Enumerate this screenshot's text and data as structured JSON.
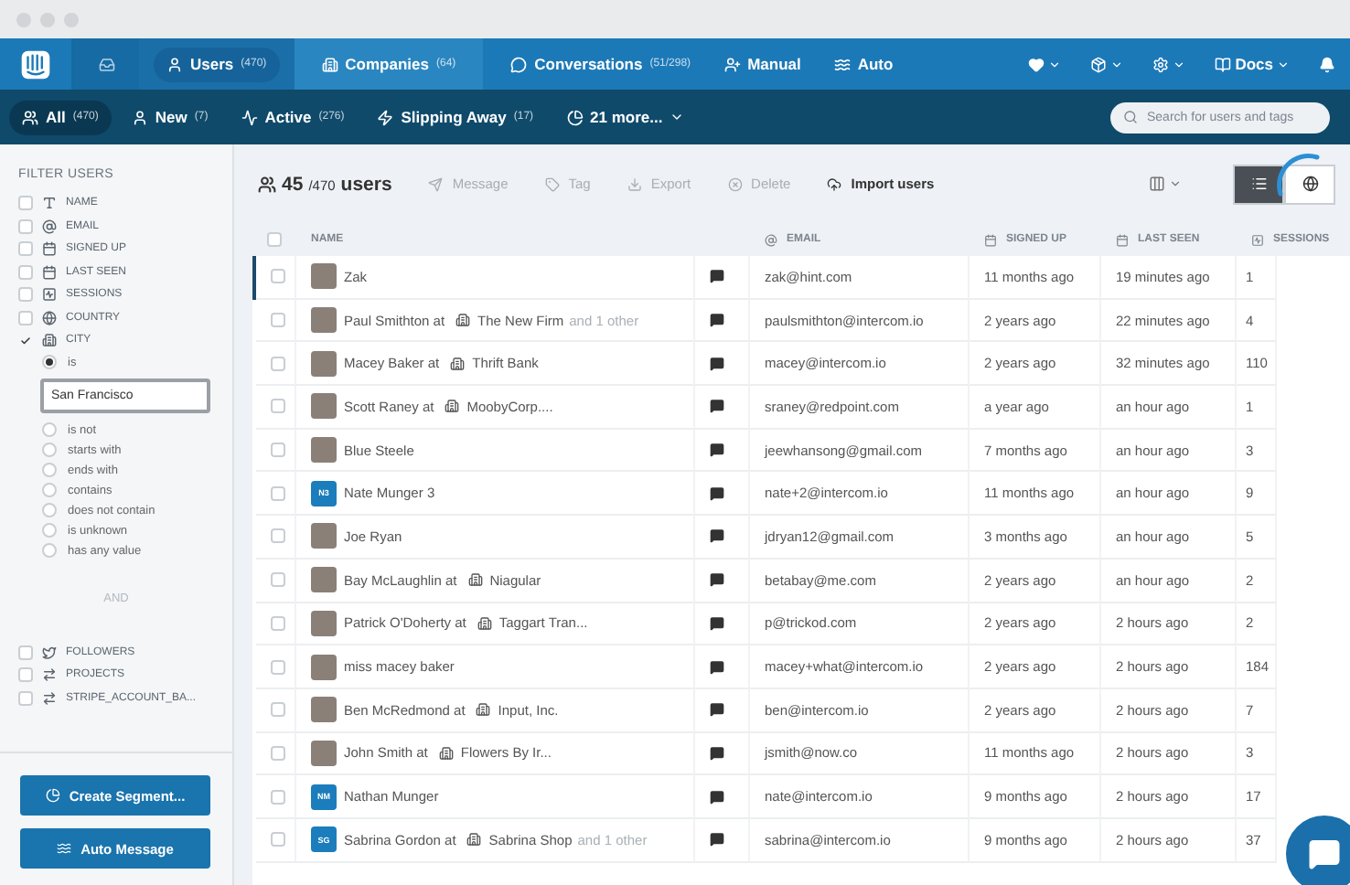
{
  "nav": {
    "tabs": [
      {
        "label": "Users",
        "count": "(470)",
        "selected": true
      },
      {
        "label": "Companies",
        "count": "(64)",
        "selected": false
      },
      {
        "label": "Conversations",
        "count": "(51/298)",
        "selected": false
      },
      {
        "label": "Manual",
        "selected": false
      },
      {
        "label": "Auto",
        "selected": false
      }
    ],
    "docs": "Docs"
  },
  "segments": {
    "items": [
      {
        "label": "All",
        "count": "(470)",
        "selected": true
      },
      {
        "label": "New",
        "count": "(7)",
        "selected": false
      },
      {
        "label": "Active",
        "count": "(276)",
        "selected": false
      },
      {
        "label": "Slipping Away",
        "count": "(17)",
        "selected": false
      },
      {
        "label": "21 more...",
        "selected": false
      }
    ],
    "search_placeholder": "Search for users and tags"
  },
  "sidebar": {
    "title": "FILTER USERS",
    "filters": [
      {
        "label": "NAME",
        "checked": false
      },
      {
        "label": "EMAIL",
        "checked": false
      },
      {
        "label": "SIGNED UP",
        "checked": false
      },
      {
        "label": "LAST SEEN",
        "checked": false
      },
      {
        "label": "SESSIONS",
        "checked": false
      },
      {
        "label": "COUNTRY",
        "checked": false
      },
      {
        "label": "CITY",
        "checked": true
      }
    ],
    "city_value": "San Francisco",
    "city_options": [
      {
        "label": "is",
        "selected": true
      },
      {
        "label": "is not",
        "selected": false
      },
      {
        "label": "starts with",
        "selected": false
      },
      {
        "label": "ends with",
        "selected": false
      },
      {
        "label": "contains",
        "selected": false
      },
      {
        "label": "does not contain",
        "selected": false
      },
      {
        "label": "is unknown",
        "selected": false
      },
      {
        "label": "has any value",
        "selected": false
      }
    ],
    "joiner": "AND",
    "more_filters": [
      {
        "label": "FOLLOWERS",
        "checked": false
      },
      {
        "label": "PROJECTS",
        "checked": false
      },
      {
        "label": "STRIPE_ACCOUNT_BA...",
        "checked": false
      }
    ],
    "buttons": [
      "Create Segment...",
      "Auto Message"
    ]
  },
  "toolbar": {
    "count": "45",
    "total": "/470",
    "unit": "users",
    "actions": [
      {
        "label": "Message",
        "disabled": true
      },
      {
        "label": "Tag",
        "disabled": true
      },
      {
        "label": "Export",
        "disabled": true
      },
      {
        "label": "Delete",
        "disabled": true
      },
      {
        "label": "Import users",
        "disabled": false
      }
    ],
    "views": [
      {
        "kind": "list",
        "selected": true
      },
      {
        "kind": "map",
        "selected": false
      }
    ]
  },
  "table": {
    "all_checked": false,
    "columns": [
      "NAME",
      "EMAIL",
      "SIGNED UP",
      "LAST SEEN",
      "SESSIONS"
    ],
    "rows": [
      {
        "avatar": {
          "kind": "photo"
        },
        "name": "Zak",
        "email": "zak@hint.com",
        "signed_up": "11 months ago",
        "last_seen": "19 minutes ago",
        "sessions": "1",
        "selected": true,
        "checked": false
      },
      {
        "avatar": {
          "kind": "photo"
        },
        "name": "Paul Smithton at",
        "company": "The New Firm",
        "extra": "and 1 other",
        "email": "paulsmithton@intercom.io",
        "signed_up": "2 years ago",
        "last_seen": "22 minutes ago",
        "sessions": "4",
        "selected": false,
        "checked": false
      },
      {
        "avatar": {
          "kind": "photo"
        },
        "name": "Macey Baker at",
        "company": "Thrift Bank",
        "email": "macey@intercom.io",
        "signed_up": "2 years ago",
        "last_seen": "32 minutes ago",
        "sessions": "110",
        "selected": false,
        "checked": false
      },
      {
        "avatar": {
          "kind": "photo"
        },
        "name": "Scott Raney at",
        "company": "MoobyCorp....",
        "email": "sraney@redpoint.com",
        "signed_up": "a year ago",
        "last_seen": "an hour ago",
        "sessions": "1",
        "selected": false,
        "checked": false
      },
      {
        "avatar": {
          "kind": "photo"
        },
        "name": "Blue Steele",
        "email": "jeewhansong@gmail.com",
        "signed_up": "7 months ago",
        "last_seen": "an hour ago",
        "sessions": "3",
        "selected": false,
        "checked": false
      },
      {
        "avatar": {
          "kind": "initials",
          "initials": "N3"
        },
        "name": "Nate Munger 3",
        "email": "nate+2@intercom.io",
        "signed_up": "11 months ago",
        "last_seen": "an hour ago",
        "sessions": "9",
        "selected": false,
        "checked": false
      },
      {
        "avatar": {
          "kind": "photo"
        },
        "name": "Joe Ryan",
        "email": "jdryan12@gmail.com",
        "signed_up": "3 months ago",
        "last_seen": "an hour ago",
        "sessions": "5",
        "selected": false,
        "checked": false
      },
      {
        "avatar": {
          "kind": "photo"
        },
        "name": "Bay McLaughlin at",
        "company": "Niagular",
        "email": "betabay@me.com",
        "signed_up": "2 years ago",
        "last_seen": "an hour ago",
        "sessions": "2",
        "selected": false,
        "checked": false
      },
      {
        "avatar": {
          "kind": "photo"
        },
        "name": "Patrick O'Doherty at",
        "company": "Taggart Tran...",
        "email": "p@trickod.com",
        "signed_up": "2 years ago",
        "last_seen": "2 hours ago",
        "sessions": "2",
        "selected": false,
        "checked": false
      },
      {
        "avatar": {
          "kind": "photo"
        },
        "name": "miss macey baker",
        "email": "macey+what@intercom.io",
        "signed_up": "2 years ago",
        "last_seen": "2 hours ago",
        "sessions": "184",
        "selected": false,
        "checked": false
      },
      {
        "avatar": {
          "kind": "photo"
        },
        "name": "Ben McRedmond at",
        "company": "Input, Inc.",
        "email": "ben@intercom.io",
        "signed_up": "2 years ago",
        "last_seen": "2 hours ago",
        "sessions": "7",
        "selected": false,
        "checked": false
      },
      {
        "avatar": {
          "kind": "photo"
        },
        "name": "John Smith at",
        "company": "Flowers By Ir...",
        "email": "jsmith@now.co",
        "signed_up": "11 months ago",
        "last_seen": "2 hours ago",
        "sessions": "3",
        "selected": false,
        "checked": false
      },
      {
        "avatar": {
          "kind": "initials",
          "initials": "NM"
        },
        "name": "Nathan Munger",
        "email": "nate@intercom.io",
        "signed_up": "9 months ago",
        "last_seen": "2 hours ago",
        "sessions": "17",
        "selected": false,
        "checked": false
      },
      {
        "avatar": {
          "kind": "initials",
          "initials": "SG"
        },
        "name": "Sabrina Gordon at",
        "company": "Sabrina Shop",
        "extra": "and 1 other",
        "email": "sabrina@intercom.io",
        "signed_up": "9 months ago",
        "last_seen": "2 hours ago",
        "sessions": "37",
        "selected": false,
        "checked": false
      }
    ]
  }
}
